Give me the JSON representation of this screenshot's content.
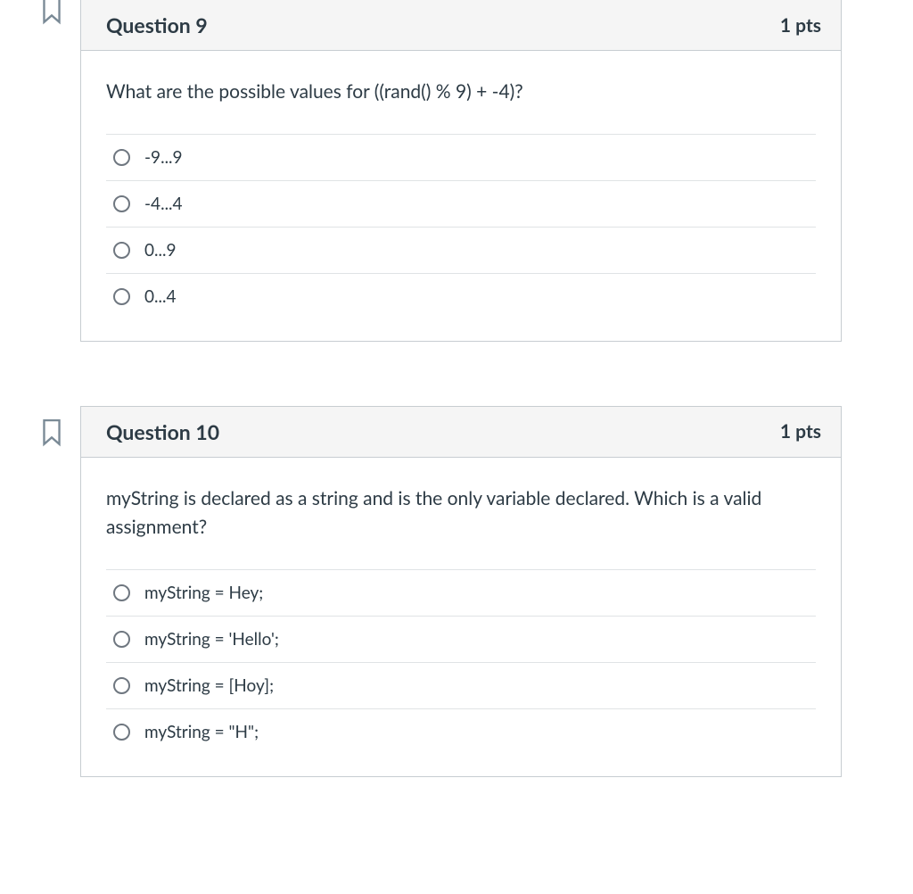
{
  "questions": [
    {
      "title": "Question 9",
      "points": "1 pts",
      "prompt": "What are the possible values for ((rand() % 9) + -4)?",
      "options": [
        "-9...9",
        "-4...4",
        "0...9",
        "0...4"
      ]
    },
    {
      "title": "Question 10",
      "points": "1 pts",
      "prompt": "myString is declared as a string and is the only variable declared. Which is a valid assignment?",
      "options": [
        "myString = Hey;",
        "myString = 'Hello';",
        "myString = [Hoy];",
        "myString = \"H\";"
      ]
    }
  ]
}
